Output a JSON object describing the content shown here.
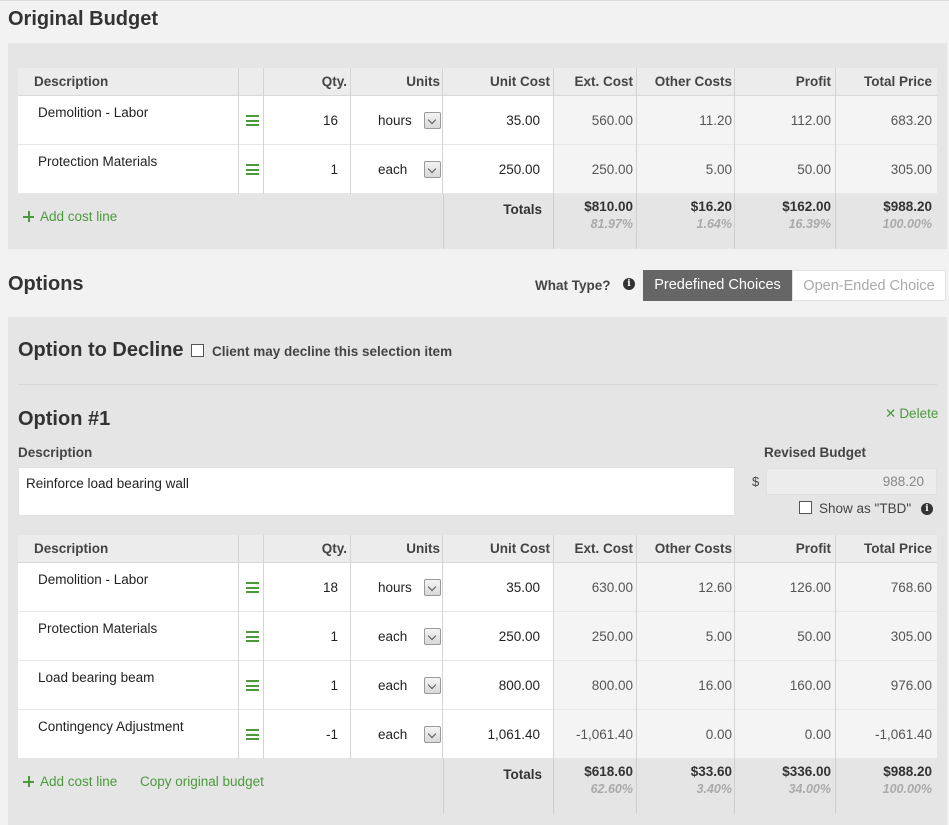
{
  "original": {
    "title": "Original Budget",
    "headers": {
      "description": "Description",
      "qty": "Qty.",
      "units": "Units",
      "unit_cost": "Unit Cost",
      "ext_cost": "Ext. Cost",
      "other_costs": "Other Costs",
      "profit": "Profit",
      "total_price": "Total Price"
    },
    "rows": [
      {
        "desc": "Demolition - Labor",
        "qty": "16",
        "units": "hours",
        "unit_cost": "35.00",
        "ext_cost": "560.00",
        "other": "11.20",
        "profit": "112.00",
        "total": "683.20"
      },
      {
        "desc": "Protection Materials",
        "qty": "1",
        "units": "each",
        "unit_cost": "250.00",
        "ext_cost": "250.00",
        "other": "5.00",
        "profit": "50.00",
        "total": "305.00"
      }
    ],
    "add_cost_line": "Add cost line",
    "totals": {
      "label": "Totals",
      "ext": "$810.00",
      "ext_pct": "81.97%",
      "other": "$16.20",
      "other_pct": "1.64%",
      "profit": "$162.00",
      "profit_pct": "16.39%",
      "total": "$988.20",
      "total_pct": "100.00%"
    }
  },
  "options": {
    "title": "Options",
    "what_type": "What Type?",
    "predefined": "Predefined Choices",
    "open_ended": "Open-Ended Choice",
    "decline_title": "Option to Decline",
    "decline_label": "Client may decline this selection item",
    "option1": {
      "title": "Option #1",
      "delete": "Delete",
      "desc_label": "Description",
      "desc_value": "Reinforce load bearing wall",
      "revised_label": "Revised Budget",
      "currency": "$",
      "revised_value": "988.20",
      "tbd_label": "Show as \"TBD\"",
      "rows": [
        {
          "desc": "Demolition - Labor",
          "qty": "18",
          "units": "hours",
          "unit_cost": "35.00",
          "ext_cost": "630.00",
          "other": "12.60",
          "profit": "126.00",
          "total": "768.60"
        },
        {
          "desc": "Protection Materials",
          "qty": "1",
          "units": "each",
          "unit_cost": "250.00",
          "ext_cost": "250.00",
          "other": "5.00",
          "profit": "50.00",
          "total": "305.00"
        },
        {
          "desc": "Load bearing beam",
          "qty": "1",
          "units": "each",
          "unit_cost": "800.00",
          "ext_cost": "800.00",
          "other": "16.00",
          "profit": "160.00",
          "total": "976.00"
        },
        {
          "desc": "Contingency Adjustment",
          "qty": "-1",
          "units": "each",
          "unit_cost": "1,061.40",
          "ext_cost": "-1,061.40",
          "other": "0.00",
          "profit": "0.00",
          "total": "-1,061.40"
        }
      ],
      "add_cost_line": "Add cost line",
      "copy_original": "Copy original budget",
      "totals": {
        "label": "Totals",
        "ext": "$618.60",
        "ext_pct": "62.60%",
        "other": "$33.60",
        "other_pct": "3.40%",
        "profit": "$336.00",
        "profit_pct": "34.00%",
        "total": "$988.20",
        "total_pct": "100.00%"
      }
    }
  },
  "colors": {
    "accent": "#4a9a3b",
    "panel": "#e5e5e5",
    "button_active": "#666666"
  }
}
